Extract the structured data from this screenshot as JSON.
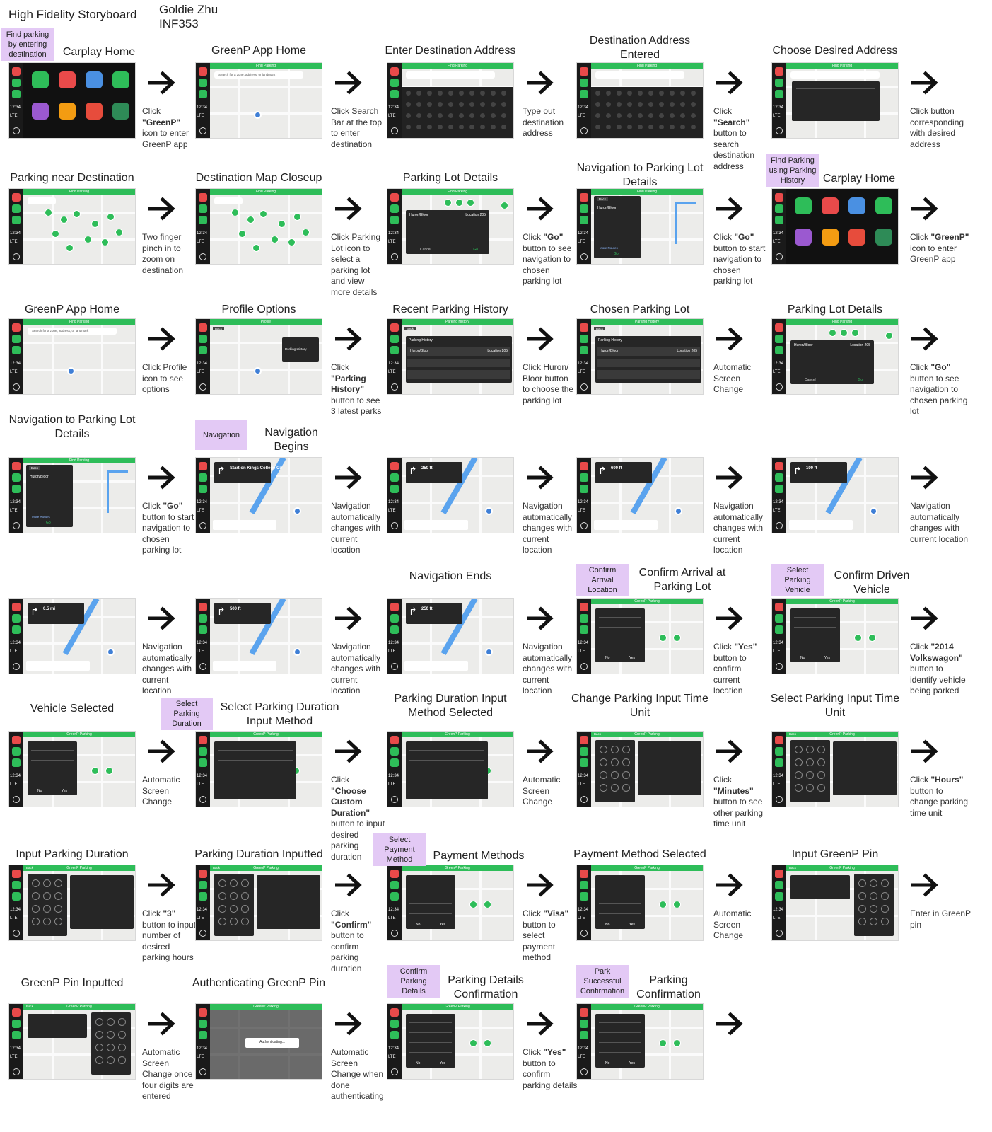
{
  "header": {
    "title": "High Fidelity Storyboard",
    "author": "Goldie Zhu",
    "course": "INF353"
  },
  "tags": [
    "Find parking by entering destination",
    "Find Parking using Parking History",
    "Navigation",
    "Confirm Arrival Location",
    "Select Parking Vehicle",
    "Select Parking Duration",
    "Select Payment Method",
    "Confirm Parking Details",
    "Park Successful Confirmation"
  ],
  "steps": [
    {
      "title": "Carplay Home",
      "caption": "Click \"GreenP\" icon to enter GreenP app",
      "screen": "home"
    },
    {
      "title": "GreenP App Home",
      "caption": "Click Search Bar at the top to enter destination",
      "screen": "map"
    },
    {
      "title": "Enter Destination Address",
      "caption": "Type out destination address",
      "screen": "keyboard"
    },
    {
      "title": "Destination Address Entered",
      "caption": "Click \"Search\" button to search destination address",
      "screen": "keyboard"
    },
    {
      "title": "Choose Desired Address",
      "caption": "Click button corresponding with desired address",
      "screen": "list"
    },
    {
      "title": "Parking near Destination",
      "caption": "Two finger pinch in to zoom on destination",
      "screen": "pins"
    },
    {
      "title": "Destination Map Closeup",
      "caption": "Click Parking Lot icon to select a parking lot and view more details",
      "screen": "pins"
    },
    {
      "title": "Parking Lot Details",
      "caption": "Click \"Go\" button to see navigation to chosen parking lot",
      "screen": "details"
    },
    {
      "title": "Navigation to Parking Lot Details",
      "caption": "Click \"Go\" button to start navigation to chosen parking lot",
      "screen": "route"
    },
    {
      "title": "Carplay Home",
      "caption": "Click \"GreenP\" icon to enter GreenP app",
      "screen": "home"
    },
    {
      "title": "GreenP App Home",
      "caption": "Click Profile icon to see options",
      "screen": "map"
    },
    {
      "title": "Profile Options",
      "caption": "Click \"Parking History\" button to see 3 latest parks",
      "screen": "menu"
    },
    {
      "title": "Recent Parking History",
      "caption": "Click Huron/ Bloor button to choose the parking lot",
      "screen": "history"
    },
    {
      "title": "Chosen Parking Lot",
      "caption": "Automatic Screen Change",
      "screen": "history"
    },
    {
      "title": "Parking Lot Details",
      "caption": "Click \"Go\" button to see navigation to chosen parking lot",
      "screen": "details"
    },
    {
      "title": "Navigation to Parking Lot Details",
      "caption": "Click \"Go\" button to start navigation to chosen parking lot",
      "screen": "route"
    },
    {
      "title": "Navigation Begins",
      "caption": "Navigation automatically changes with current location",
      "screen": "nav",
      "turn": "Start on Kings College Cir"
    },
    {
      "title": "",
      "caption": "Navigation automatically changes with current location",
      "screen": "nav",
      "turn": "250 ft"
    },
    {
      "title": "",
      "caption": "Navigation automatically changes with current location",
      "screen": "nav",
      "turn": "600 ft"
    },
    {
      "title": "",
      "caption": "Navigation automatically changes with current location",
      "screen": "nav",
      "turn": "100 ft"
    },
    {
      "title": "",
      "caption": "Navigation automatically changes with current location",
      "screen": "nav",
      "turn": "0.5 mi"
    },
    {
      "title": "",
      "caption": "Navigation automatically changes with current location",
      "screen": "nav",
      "turn": "500 ft"
    },
    {
      "title": "Navigation Ends",
      "caption": "Navigation automatically changes with current location",
      "screen": "nav",
      "turn": "250 ft"
    },
    {
      "title": "Confirm Arrival at Parking Lot",
      "caption": "Click \"Yes\" button to confirm current location",
      "screen": "dialog"
    },
    {
      "title": "Confirm Driven Vehicle",
      "caption": "Click \"2014 Volkswagon\" button to identify vehicle being parked",
      "screen": "dialog"
    },
    {
      "title": "Vehicle Selected",
      "caption": "Automatic Screen Change",
      "screen": "dialog"
    },
    {
      "title": "Select Parking Duration Input Method",
      "caption": "Click \"Choose Custom Duration\" button to input desired parking duration",
      "screen": "rates"
    },
    {
      "title": "Parking Duration Input Method Selected",
      "caption": "Automatic Screen Change",
      "screen": "rates"
    },
    {
      "title": "Change Parking Input Time Unit",
      "caption": "Click \"Minutes\" button to see other parking time unit",
      "screen": "keypad"
    },
    {
      "title": "Select Parking Input Time Unit",
      "caption": "Click \"Hours\" button to change parking time unit",
      "screen": "keypad"
    },
    {
      "title": "Input Parking Duration",
      "caption": "Click \"3\" button to input number of desired parking hours",
      "screen": "keypad"
    },
    {
      "title": "Parking Duration Inputted",
      "caption": "Click \"Confirm\" button to confirm parking duration",
      "screen": "keypad"
    },
    {
      "title": "Payment Methods",
      "caption": "Click \"Visa\" button to select payment method",
      "screen": "dialog"
    },
    {
      "title": "Payment Method Selected",
      "caption": "Automatic Screen Change",
      "screen": "dialog"
    },
    {
      "title": "Input GreenP Pin",
      "caption": "Enter in GreenP pin",
      "screen": "pinpad"
    },
    {
      "title": "GreenP Pin Inputted",
      "caption": "Automatic Screen Change once four digits are entered",
      "screen": "pinpad"
    },
    {
      "title": "Authenticating GreenP Pin",
      "caption": "Automatic Screen Change when done authenticating",
      "screen": "auth"
    },
    {
      "title": "Parking Details Confirmation",
      "caption": "Click \"Yes\" button to confirm parking details",
      "screen": "dialog"
    },
    {
      "title": "Parking Confirmation",
      "caption": "",
      "screen": "dialog"
    }
  ],
  "screen_text": {
    "app_bar": "Find Parking",
    "app_bar_2": "GreenP Parking",
    "search_placeholder": "Search for a zone, address, or landmark",
    "back": "Back",
    "go": "Go",
    "cancel": "Cancel",
    "yes": "Yes",
    "no": "No",
    "confirm": "Confirm",
    "authenticating": "Authenticating...",
    "lot_name": "Huron/Bloor",
    "lot_location": "Location 205",
    "parking_history": "Parking History",
    "more_routes": "More Routes",
    "time": "12:34",
    "lte": "LTE"
  },
  "colors": {
    "green": "#2ebd59",
    "tag": "#e3c9f5",
    "dark": "#1a1a1a",
    "route": "#5aa3ee"
  }
}
